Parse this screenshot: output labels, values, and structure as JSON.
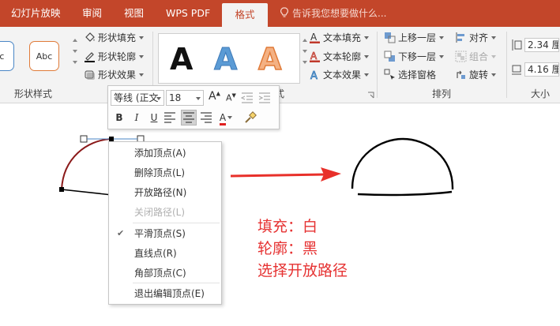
{
  "tabs": [
    {
      "label": "幻灯片放映",
      "active": false
    },
    {
      "label": "审阅",
      "active": false
    },
    {
      "label": "视图",
      "active": false
    },
    {
      "label": "WPS PDF",
      "active": false
    },
    {
      "label": "格式",
      "active": true
    }
  ],
  "tell_me": "告诉我您想要做什么...",
  "colors": {
    "tab_bar": "#c3462a",
    "ribbon": "#f3f3f3",
    "annotation": "#e63232",
    "arrow": "#e8302a"
  },
  "ribbon": {
    "shape_styles": {
      "preview_partial": "oc",
      "preview": "Abc",
      "fill": "形状填充",
      "outline": "形状轮廓",
      "effects": "形状效果",
      "label": "形状样式"
    },
    "wordart": {
      "sample": "A",
      "text_fill": "文本填充",
      "text_outline": "文本轮廓",
      "text_effects": "文本效果",
      "label_partial": "式"
    },
    "arrange": {
      "bring_forward": "上移一层",
      "send_backward": "下移一层",
      "selection_pane": "选择窗格",
      "align": "对齐",
      "group": "组合",
      "rotate": "旋转",
      "label": "排列"
    },
    "size": {
      "height": "2.34 厘",
      "width": "4.16 厘",
      "label": "大小"
    }
  },
  "mini_toolbar": {
    "font": "等线 (正文",
    "size": "18",
    "grow": "A",
    "shrink": "A",
    "bold": "B",
    "italic": "I",
    "underline": "U",
    "font_color": "A"
  },
  "context_menu": [
    {
      "label": "添加顶点(A)",
      "enabled": true,
      "checked": false
    },
    {
      "label": "删除顶点(L)",
      "enabled": true,
      "checked": false
    },
    {
      "label": "开放路径(N)",
      "enabled": true,
      "checked": false
    },
    {
      "label": "关闭路径(L)",
      "enabled": false,
      "checked": false
    },
    {
      "label": "平滑顶点(S)",
      "enabled": true,
      "checked": true
    },
    {
      "label": "直线点(R)",
      "enabled": true,
      "checked": false
    },
    {
      "label": "角部顶点(C)",
      "enabled": true,
      "checked": false
    },
    {
      "label": "退出编辑顶点(E)",
      "enabled": true,
      "checked": false
    }
  ],
  "annotation": {
    "line1": "填充：白",
    "line2": "轮廓：黑",
    "line3": "选择开放路径"
  }
}
